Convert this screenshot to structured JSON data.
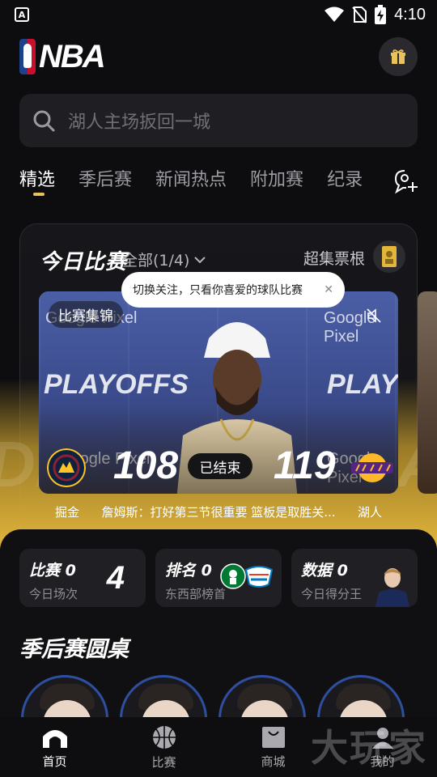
{
  "status_bar": {
    "time": "4:10"
  },
  "header": {
    "logo_text": "NBA"
  },
  "search": {
    "placeholder": "湖人主场扳回一城"
  },
  "tabs": [
    {
      "label": "精选",
      "active": true
    },
    {
      "label": "季后赛",
      "active": false
    },
    {
      "label": "新闻热点",
      "active": false
    },
    {
      "label": "附加赛",
      "active": false
    },
    {
      "label": "纪录",
      "active": false
    }
  ],
  "today": {
    "title": "今日比赛",
    "filter_label": "全部(1/4)",
    "tickets_label": "超集票根"
  },
  "tooltip": {
    "text": "切换关注，只看你喜爱的球队比赛"
  },
  "featured_game": {
    "video_tag": "比赛集锦",
    "home_team": "掘金",
    "away_team": "湖人",
    "home_score": "108",
    "away_score": "119",
    "status": "已结束",
    "headline": "詹姆斯：打好第三节很重要 篮板是取胜关...",
    "watermark_playoffs": "PLAYOFFS",
    "watermark_sponsor": "Google Pixel",
    "bg_word_left": "DEN",
    "bg_word_right": "LA",
    "home_color": "#0e2240",
    "away_color": "#552583"
  },
  "stats": [
    {
      "title": "比赛 0",
      "subtitle": "今日场次",
      "value": "4"
    },
    {
      "title": "排名 0",
      "subtitle": "东西部榜首",
      "value": ""
    },
    {
      "title": "数据 0",
      "subtitle": "今日得分王",
      "value": ""
    }
  ],
  "roundtable": {
    "title": "季后赛圆桌"
  },
  "bottom_nav": [
    {
      "label": "首页",
      "icon": "home-icon",
      "active": true
    },
    {
      "label": "比赛",
      "icon": "basketball-icon",
      "active": false
    },
    {
      "label": "商城",
      "icon": "shopping-bag-icon",
      "active": false
    },
    {
      "label": "我的",
      "icon": "profile-icon",
      "active": false
    }
  ],
  "watermark": "大玩家",
  "colors": {
    "accent": "#e9c35a",
    "background": "#0d0d10",
    "card": "#202024"
  }
}
